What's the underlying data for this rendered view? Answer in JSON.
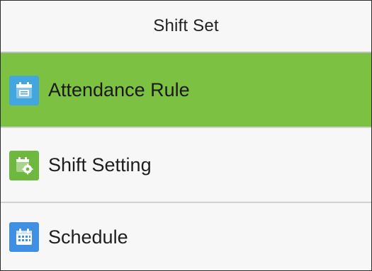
{
  "header": {
    "title": "Shift Set"
  },
  "menu": {
    "items": [
      {
        "label": "Attendance Rule",
        "icon": "attendance-rule-icon",
        "icon_color": "#44a6de",
        "selected": true
      },
      {
        "label": "Shift Setting",
        "icon": "shift-setting-icon",
        "icon_color": "#6fb83f",
        "selected": false
      },
      {
        "label": "Schedule",
        "icon": "schedule-icon",
        "icon_color": "#3f8fe3",
        "selected": false
      }
    ]
  },
  "colors": {
    "selected_bg": "#7cc142",
    "background": "#f7f7f7",
    "divider": "#d2d2d2"
  }
}
